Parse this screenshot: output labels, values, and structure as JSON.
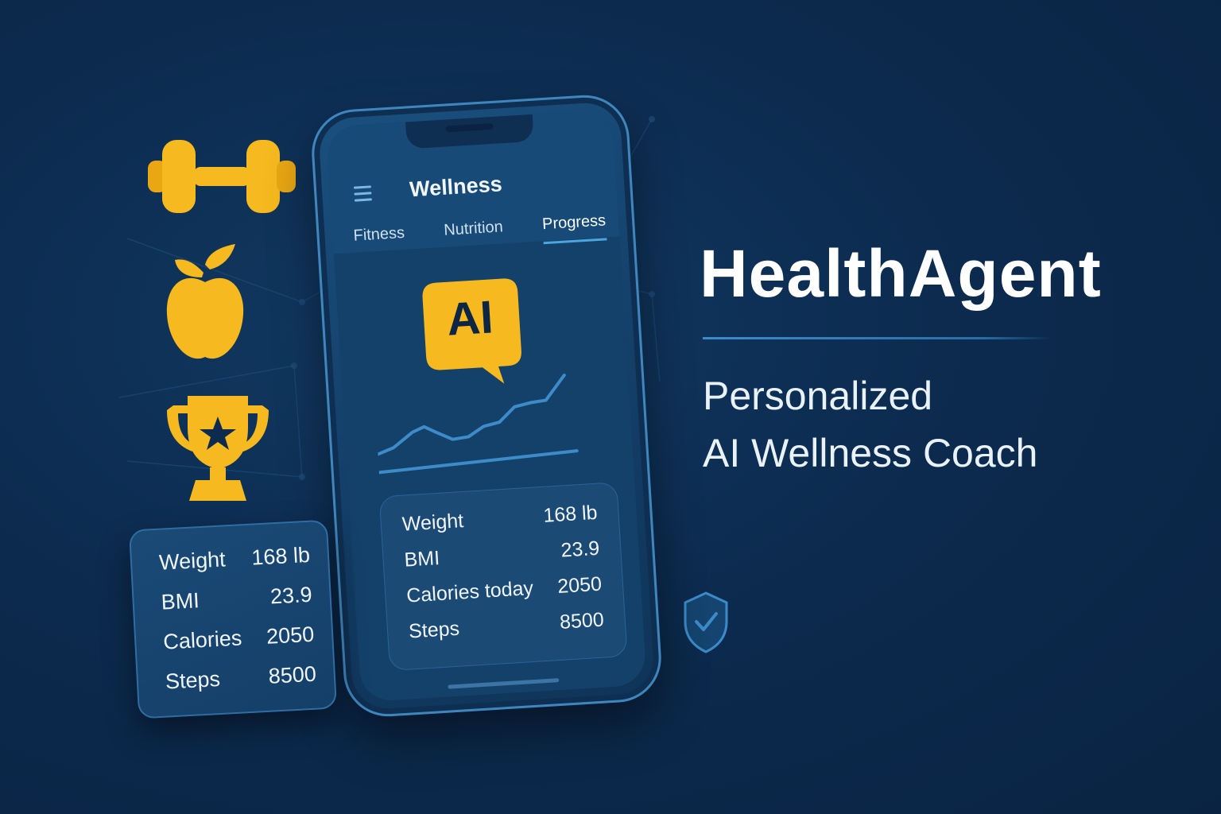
{
  "brand": {
    "name": "HealthAgent",
    "tagline_line1": "Personalized",
    "tagline_line2": "AI Wellness Coach"
  },
  "colors": {
    "background": "#0c2b4f",
    "accent_gold": "#f6b91f",
    "accent_blue": "#3d8cc9"
  },
  "side_icons": [
    "dumbbell-icon",
    "apple-icon",
    "trophy-icon",
    "shield-check-icon"
  ],
  "app": {
    "title": "Wellness",
    "tabs": [
      {
        "label": "Fitness",
        "active": false
      },
      {
        "label": "Nutrition",
        "active": false
      },
      {
        "label": "Progress",
        "active": true
      }
    ],
    "ai_badge": "AI",
    "stats": [
      {
        "label": "Weight",
        "value": "168 lb"
      },
      {
        "label": "BMI",
        "value": "23.9"
      },
      {
        "label": "Calories today",
        "value": "2050"
      },
      {
        "label": "Steps",
        "value": "8500"
      }
    ]
  },
  "card": {
    "stats": [
      {
        "label": "Weight",
        "value": "168 lb"
      },
      {
        "label": "BMI",
        "value": "23.9"
      },
      {
        "label": "Calories",
        "value": "2050"
      },
      {
        "label": "Steps",
        "value": "8500"
      }
    ]
  }
}
